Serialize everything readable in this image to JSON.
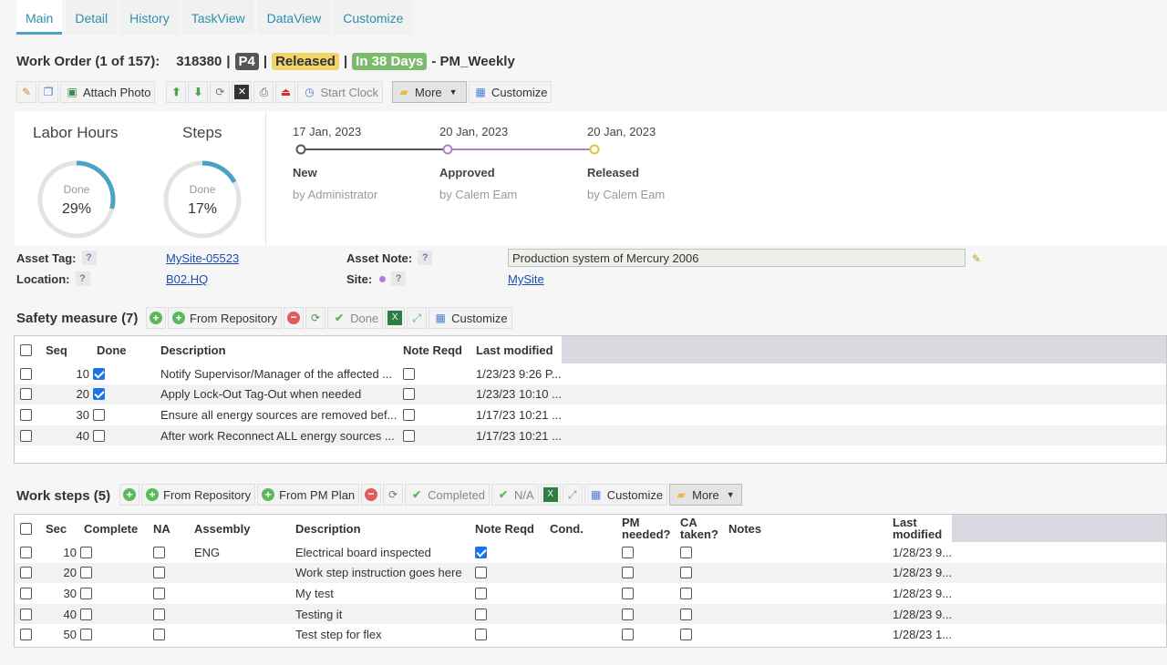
{
  "tabs": [
    "Main",
    "Detail",
    "History",
    "TaskView",
    "DataView",
    "Customize"
  ],
  "header": {
    "title": "Work Order (1 of 157):",
    "number": "318380",
    "priority": "P4",
    "status": "Released",
    "due": "In 38 Days",
    "pm": "- PM_Weekly"
  },
  "toolbar": {
    "attach_photo": "Attach Photo",
    "start_clock": "Start Clock",
    "more": "More",
    "customize": "Customize"
  },
  "gauges": [
    {
      "title": "Labor Hours",
      "done_label": "Done",
      "percent_text": "29%",
      "percent": 29
    },
    {
      "title": "Steps",
      "done_label": "Done",
      "percent_text": "17%",
      "percent": 17
    }
  ],
  "timeline": [
    {
      "date": "17 Jan, 2023",
      "state": "New",
      "by": "by Administrator",
      "color": "#555555"
    },
    {
      "date": "20 Jan, 2023",
      "state": "Approved",
      "by": "by Calem Eam",
      "color": "#b07fd2"
    },
    {
      "date": "20 Jan, 2023",
      "state": "Released",
      "by": "by Calem Eam",
      "color": "#e6c23a"
    }
  ],
  "fields": {
    "asset_tag_label": "Asset Tag:",
    "asset_tag_value": "MySite-05523",
    "location_label": "Location:",
    "location_value": "B02.HQ",
    "asset_note_label": "Asset Note:",
    "asset_note_value": "Production system of Mercury 2006",
    "site_label": "Site:",
    "site_value": "MySite",
    "help": "?"
  },
  "safety": {
    "title": "Safety measure (7)",
    "toolbar": {
      "from_repository": "From Repository",
      "done": "Done",
      "customize": "Customize"
    },
    "columns": [
      "Seq",
      "Done",
      "Description",
      "Note Reqd",
      "Last modified"
    ],
    "rows": [
      {
        "seq": "10",
        "done": true,
        "description": "Notify Supervisor/Manager of the affected ...",
        "note": false,
        "modified": "1/23/23 9:26 P..."
      },
      {
        "seq": "20",
        "done": true,
        "description": "Apply Lock-Out Tag-Out when needed",
        "note": false,
        "modified": "1/23/23 10:10 ..."
      },
      {
        "seq": "30",
        "done": false,
        "description": "Ensure all energy sources are removed bef...",
        "note": false,
        "modified": "1/17/23 10:21 ..."
      },
      {
        "seq": "40",
        "done": false,
        "description": "After work Reconnect ALL energy sources ...",
        "note": false,
        "modified": "1/17/23 10:21 ..."
      }
    ]
  },
  "worksteps": {
    "title": "Work steps (5)",
    "toolbar": {
      "from_repository": "From Repository",
      "from_pm_plan": "From PM Plan",
      "completed": "Completed",
      "na": "N/A",
      "customize": "Customize",
      "more": "More"
    },
    "columns": [
      "Sec",
      "Complete",
      "NA",
      "Assembly",
      "Description",
      "Note Reqd",
      "Cond.",
      "PM needed?",
      "CA taken?",
      "Notes",
      "Last modified"
    ],
    "rows": [
      {
        "seq": "10",
        "assembly": "ENG",
        "description": "Electrical board inspected",
        "note": true,
        "modified": "1/28/23 9..."
      },
      {
        "seq": "20",
        "assembly": "",
        "description": "Work step instruction goes here",
        "note": false,
        "modified": "1/28/23 9..."
      },
      {
        "seq": "30",
        "assembly": "",
        "description": "My test",
        "note": false,
        "modified": "1/28/23 9..."
      },
      {
        "seq": "40",
        "assembly": "",
        "description": "Testing it",
        "note": false,
        "modified": "1/28/23 9..."
      },
      {
        "seq": "50",
        "assembly": "",
        "description": "Test step for flex",
        "note": false,
        "modified": "1/28/23 1..."
      }
    ]
  }
}
